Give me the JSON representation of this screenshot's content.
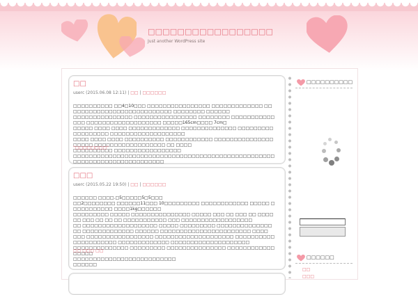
{
  "site": {
    "title": "□□□□□□□□□□□□□□□□□",
    "tagline": "Just another WordPress site"
  },
  "posts": [
    {
      "title": "□□",
      "meta": {
        "author_date": "userc (2015.06.08 12:11)",
        "sep1": " | ",
        "link1": "□□",
        "sep2": " | ",
        "link2": "□□□□□□"
      },
      "body": "□□□□□□□□□□ □□4□10□□□ □□□□□□□□□□□□□□□□ □□□□□□□□□□□□□ □□□□□□□□□□□□□□□□□□□□□□□□□□□ □□□□□□□□ □□□□□□\n□□□□□□□□□□□□□□□ □□□□□□□□□□□□□□□□ □□□□□□□□ □□□□□□□□□□□□□□ □□□□□□□□□□□□□□□□□□□ □□□□□165cm□□□□ 7cm□\n□□□□□ □□□□ □□□□ □□□□□□□□□□□□□ □□□□□□□□□□□□□□ □□□□□□□□□□□□□□□□□□ □□□□□□□□□□□□□□□□□□□\n□□□□ □□□□ □□□□ □□□□□□□□□□ □□□□□□□□□□□□ □□□□□□□□□□□□□□□□□□□□ □□□□□□□□□□□□□□□□□□ □□ □□□□\n□□□□□□□□□□ □□□□□□□□□□□□□□□□□\n□□□□□□□□□□□□□□□□□□□□□□□□□□□□□□□□□□□□□□□□□□□□□□□□□□□□□□□□□□□□□□□□□□□□□□□□□□",
      "more": "\"□□□□□□□□\""
    },
    {
      "title": "□□□",
      "meta": {
        "author_date": "userc (2015.05.22 19:50)",
        "sep1": " | ",
        "link1": "□□",
        "sep2": " | ",
        "link2": "□□□□□□"
      },
      "body": "□□□□□□ □□□□.□5□□□□□5□5□□□\n□□2□□□□□□□□ □□□□□□11□□□ 10□□□□□□□□□ □□□□□□□□□□□□ □□□□□ □□□□□□□□□□□ □□□□1kg□□□□□□\n□□□□□□□□□ □□□□□ □□□□□□□□□□□□□□□ □□□□□ □□□ □□ □□□ □□ □□□□ □□ □□□ □□ □□ □□ □□□□□□□□□□□ □□□ □□□□□□□□□□□□□□□□□□\n□□ □□□□□□□□□□□□□□□□□□□ □□□□□ □□□□□□□□□ □□□□□□□□□□□□□□□□ □□□□□□□□□□□□□ □□□□□□ □□□□□□□□□□□□□□□□□□□□□□□ □□□□\n□□□ □□□□□□□□□□□□□□□□□ □□□□□□□□□□□□□□□□□□□□ □□□□□□□□□□□□□□□□□□□□□ □□□□□□□□□□□□□ □□□□□□□□□□□□□□□□□□□□\n□□□□□□□□□□□□□□ □□□□□□□□□ □□□□□□□□□□□□□□□ □□□□□□□□□□□□□□□□□\n□□□□□□□□□□□□□□□□□□□□□□□□□□\n□□□□□□",
      "more": "□□ □□□ □□"
    }
  ],
  "sidebar": {
    "widget1_title": "□□□□□□□□□□",
    "widget2_title": "□□□□□□",
    "categories": [
      "□□",
      "□□□"
    ]
  },
  "icons": {
    "heart": "heart-icon",
    "spinner": "loading-spinner-icon"
  },
  "colors": {
    "accent": "#e36b78",
    "header_bg": "#fbd6dc",
    "heart_pink": "#f7a8b3",
    "heart_orange": "#f9c38f"
  }
}
